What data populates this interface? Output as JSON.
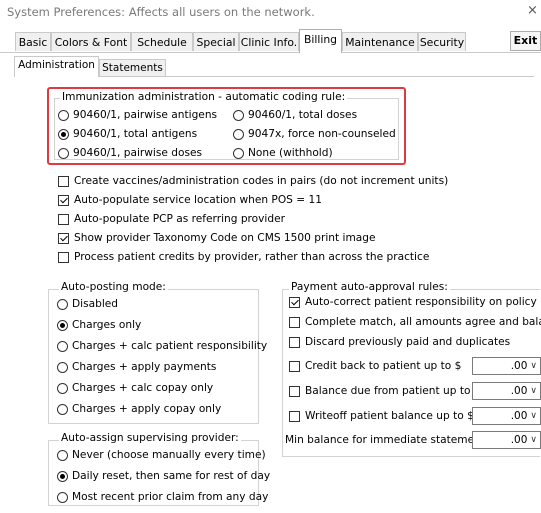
{
  "window": {
    "title": "System Preferences: Affects all users on the network.",
    "close_glyph": "×"
  },
  "tabs": [
    "Basic",
    "Colors & Font",
    "Schedule",
    "Special",
    "Clinic Info.",
    "Billing",
    "Maintenance",
    "Security"
  ],
  "active_tab": "Billing",
  "exit_label": "Exit",
  "subtabs": [
    "Administration",
    "Statements"
  ],
  "active_subtab": "Administration",
  "immunization": {
    "legend": "Immunization administration - automatic coding rule:",
    "options": [
      "90460/1, pairwise antigens",
      "90460/1, total doses",
      "90460/1, total antigens",
      "9047x, force non-counseled",
      "90460/1, pairwise doses",
      "None (withhold)"
    ],
    "selected": "90460/1, total antigens"
  },
  "checkboxes": [
    {
      "label": "Create vaccines/administration codes in pairs (do not increment units)",
      "checked": false
    },
    {
      "label": "Auto-populate service location when POS = 11",
      "checked": true
    },
    {
      "label": "Auto-populate PCP as referring provider",
      "checked": false
    },
    {
      "label": "Show provider Taxonomy Code on CMS 1500 print image",
      "checked": true
    },
    {
      "label": "Process patient credits by provider, rather than across the practice",
      "checked": false
    }
  ],
  "auto_posting": {
    "legend": "Auto-posting mode:",
    "options": [
      "Disabled",
      "Charges only",
      "Charges + calc patient responsibility",
      "Charges + apply payments",
      "Charges + calc copay only",
      "Charges + apply copay only"
    ],
    "selected": "Charges only"
  },
  "supervising": {
    "legend": "Auto-assign supervising provider:",
    "options": [
      "Never (choose manually every time)",
      "Daily reset, then same for rest of day",
      "Most recent prior claim from any day"
    ],
    "selected": "Daily reset, then same for rest of day"
  },
  "payment": {
    "legend": "Payment auto-approval rules:",
    "rules": [
      {
        "label": "Auto-correct patient responsibility on policy",
        "checked": true
      },
      {
        "label": "Complete match, all amounts agree and balance",
        "checked": false
      },
      {
        "label": "Discard previously paid and duplicates",
        "checked": false
      }
    ],
    "amount_rules": [
      {
        "label": "Credit back to patient up to $",
        "checked": false,
        "value": ".00"
      },
      {
        "label": "Balance due from patient up to $",
        "checked": false,
        "value": ".00"
      },
      {
        "label": "Writeoff patient balance up to $",
        "checked": false,
        "value": ".00"
      }
    ],
    "min_balance_label": "Min balance for immediate statement",
    "min_balance_value": ".00"
  },
  "colors": {
    "highlight": "#e03a3e"
  },
  "icons": {
    "close": "close-icon",
    "dropdown": "chevron-down-icon"
  }
}
